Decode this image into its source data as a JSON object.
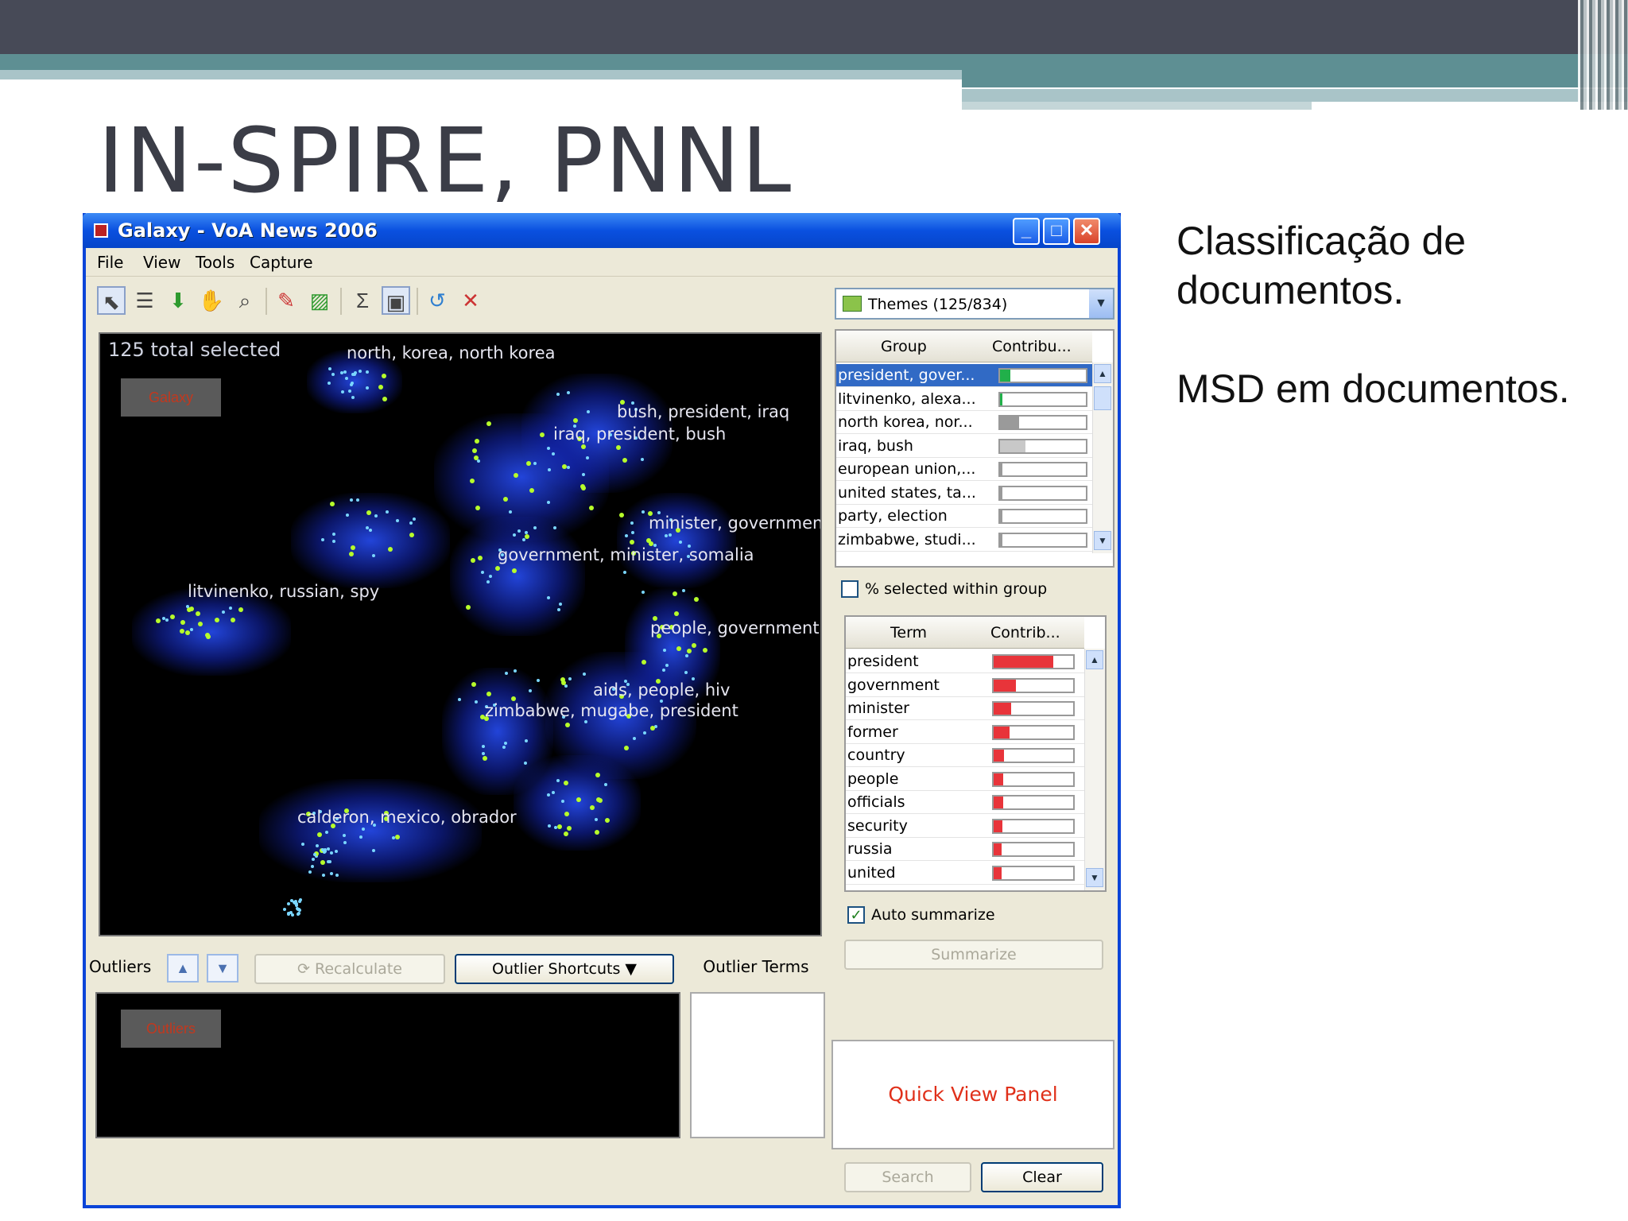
{
  "slide": {
    "title": "IN-SPIRE, PNNL",
    "side_text_1": "Classificação de documentos.",
    "side_text_2": "MSD em documentos."
  },
  "window": {
    "title": "Galaxy - VoA News 2006",
    "controls": {
      "minimize": "_",
      "maximize": "□",
      "close": "✕"
    }
  },
  "menu": [
    "File",
    "View",
    "Tools",
    "Capture"
  ],
  "toolbar_icons": [
    "pointer-icon",
    "align-icon",
    "down-arrow-icon",
    "hand-icon",
    "zoom-icon",
    "eraser-icon",
    "select-region-icon",
    "sum-icon",
    "panel-icon",
    "undo-icon",
    "tools-icon"
  ],
  "galaxy": {
    "selected_text": "125 total selected",
    "redbox_label": "Galaxy",
    "labels": [
      "north, korea, north korea",
      "bush, president, iraq",
      "iraq, president, bush",
      "minister, government",
      "government, minister, somalia",
      "litvinenko, russian, spy",
      "people, government",
      "aids, people, hiv",
      "zimbabwe, mugabe, president",
      "calderon, mexico, obrador"
    ]
  },
  "themes": {
    "combo_text": "Themes (125/834)",
    "col_group": "Group",
    "col_contrib": "Contribu...",
    "rows": [
      {
        "name": "president, gover...",
        "fill": 0.12,
        "color": "#21b04a",
        "selected": true
      },
      {
        "name": "litvinenko, alexa...",
        "fill": 0.03,
        "color": "#21b04a"
      },
      {
        "name": "north korea, nor...",
        "fill": 0.22,
        "color": "#9a9a9a"
      },
      {
        "name": "iraq, bush",
        "fill": 0.3,
        "color": "#c8c8c8"
      },
      {
        "name": "european union,...",
        "fill": 0.03,
        "color": "#9a9a9a"
      },
      {
        "name": "united states, ta...",
        "fill": 0.03,
        "color": "#9a9a9a"
      },
      {
        "name": "party, election",
        "fill": 0.03,
        "color": "#9a9a9a"
      },
      {
        "name": "zimbabwe, studi...",
        "fill": 0.03,
        "color": "#9a9a9a"
      }
    ],
    "checkbox_label": "% selected within group"
  },
  "terms": {
    "col_term": "Term",
    "col_contrib": "Contrib...",
    "rows": [
      {
        "name": "president",
        "fill": 0.75
      },
      {
        "name": "government",
        "fill": 0.28
      },
      {
        "name": "minister",
        "fill": 0.22
      },
      {
        "name": "former",
        "fill": 0.2
      },
      {
        "name": "country",
        "fill": 0.13
      },
      {
        "name": "people",
        "fill": 0.12
      },
      {
        "name": "officials",
        "fill": 0.12
      },
      {
        "name": "security",
        "fill": 0.11
      },
      {
        "name": "russia",
        "fill": 0.1
      },
      {
        "name": "united",
        "fill": 0.1
      }
    ],
    "auto_summarize_label": "Auto summarize",
    "auto_summarize_checked": true,
    "summarize_button": "Summarize"
  },
  "quick_view": "Quick View Panel",
  "search_button": "Search",
  "clear_button": "Clear",
  "outliers": {
    "label": "Outliers",
    "up": "▲",
    "down": "▼",
    "recalculate": "Recalculate",
    "shortcuts": "Outlier Shortcuts ▼",
    "terms_label": "Outlier Terms",
    "redbox_label": "Outliers"
  },
  "colors": {
    "term_bar": "#e8343a",
    "title_bar": "#0a50e0",
    "galaxy_glow": "#2850ff",
    "point_green": "#b7ff2a"
  }
}
